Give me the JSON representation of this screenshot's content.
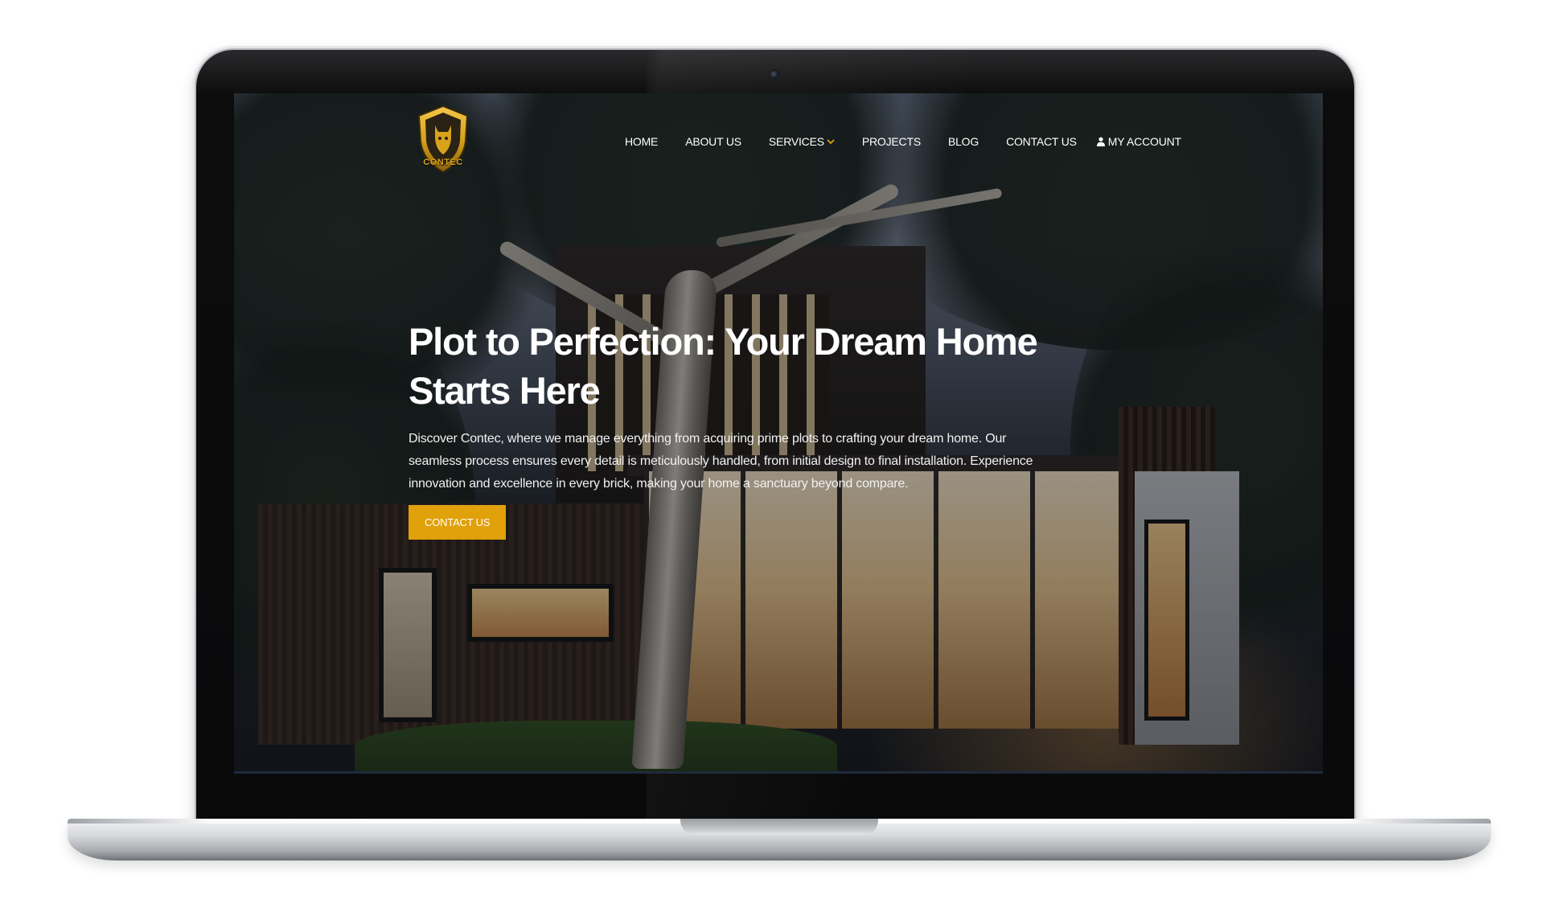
{
  "site": {
    "logo_text": "CONTEC"
  },
  "nav": {
    "items": [
      {
        "label": "HOME"
      },
      {
        "label": "ABOUT US"
      },
      {
        "label": "SERVICES"
      },
      {
        "label": "PROJECTS"
      },
      {
        "label": "BLOG"
      },
      {
        "label": "CONTACT US"
      },
      {
        "label": "MY ACCOUNT"
      }
    ]
  },
  "hero": {
    "title": "Plot to Perfection: Your Dream Home Starts Here",
    "description": "Discover Contec, where we manage everything from acquiring prime plots to crafting your dream home. Our seamless process ensures every detail is meticulously handled, from initial design to final installation. Experience innovation and excellence in every brick, making your home a sanctuary beyond compare.",
    "button_label": "CONTACT US"
  },
  "colors": {
    "accent": "#e0a10a",
    "logo_gold": "#d9a21b",
    "text_light": "#ffffff"
  },
  "icons": {
    "logo": "shield-cat-logo",
    "services_dropdown": "chevron-down-icon",
    "account": "user-icon",
    "camera": "webcam-icon"
  }
}
